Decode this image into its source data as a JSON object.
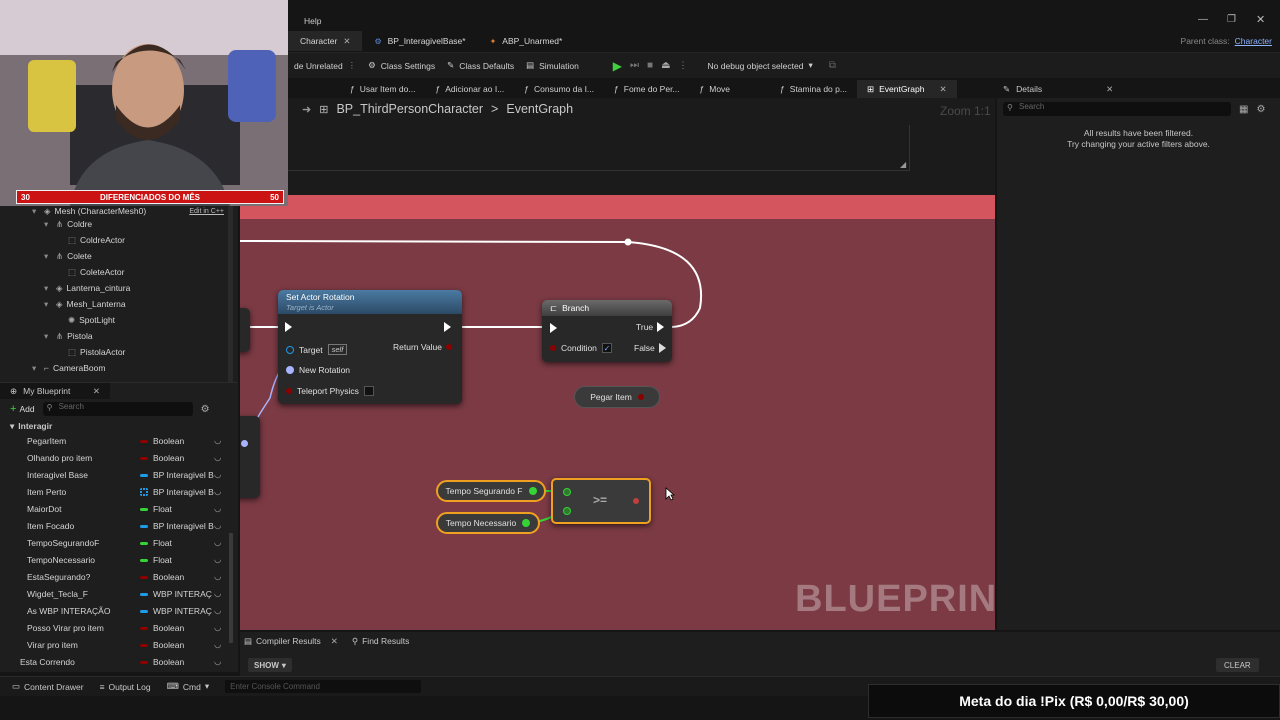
{
  "menubar": {
    "help_label": "Help",
    "parent_class_label": "Parent class:",
    "parent_class_value": "Character"
  },
  "tabs": [
    {
      "label": "Character",
      "closable": true
    },
    {
      "label": "BP_InteragivelBase*",
      "closable": false
    },
    {
      "label": "ABP_Unarmed*",
      "closable": false
    }
  ],
  "toolbar": {
    "hide_unrelated": "de Unrelated",
    "class_settings": "Class Settings",
    "class_defaults": "Class Defaults",
    "simulation": "Simulation",
    "debug_select": "No debug object selected"
  },
  "graph_tabs": [
    {
      "label": "Usar Item do..."
    },
    {
      "label": "Adicionar ao I..."
    },
    {
      "label": "Consumo da I..."
    },
    {
      "label": "Fome do Per..."
    },
    {
      "label": "Move"
    },
    {
      "label": "Stamina do p..."
    },
    {
      "label": "EventGraph",
      "active": true
    }
  ],
  "breadcrumb": {
    "root": "BP_ThirdPersonCharacter",
    "separator": ">",
    "current": "EventGraph",
    "zoom": "Zoom 1:1"
  },
  "webcam": {
    "banner_left": "30",
    "banner_text": "DIFERENCIADOS DO MÊS",
    "banner_right": "50"
  },
  "components_tree": [
    {
      "label": "Mesh (CharacterMesh0)",
      "indent": 1,
      "icon": "mesh",
      "extra": "Edit in C++"
    },
    {
      "label": "Coldre",
      "indent": 2,
      "icon": "scene"
    },
    {
      "label": "ColdreActor",
      "indent": 3,
      "icon": "actor"
    },
    {
      "label": "Colete",
      "indent": 2,
      "icon": "scene"
    },
    {
      "label": "ColeteActor",
      "indent": 3,
      "icon": "actor"
    },
    {
      "label": "Lanterna_cintura",
      "indent": 2,
      "icon": "mesh"
    },
    {
      "label": "Mesh_Lanterna",
      "indent": 2,
      "icon": "mesh"
    },
    {
      "label": "SpotLight",
      "indent": 3,
      "icon": "light"
    },
    {
      "label": "Pistola",
      "indent": 2,
      "icon": "scene"
    },
    {
      "label": "PistolaActor",
      "indent": 3,
      "icon": "actor"
    },
    {
      "label": "CameraBoom",
      "indent": 1,
      "icon": "camera"
    }
  ],
  "my_blueprint": {
    "title": "My Blueprint",
    "add_label": "Add",
    "search_placeholder": "Search",
    "category": "Interagir",
    "variables": [
      {
        "name": "PegarItem",
        "type": "Boolean",
        "color": "#8c0000"
      },
      {
        "name": "Olhando pro item",
        "type": "Boolean",
        "color": "#8c0000"
      },
      {
        "name": "Interagivel Base",
        "type": "BP Interagivel B",
        "color": "#1e9be8"
      },
      {
        "name": "Item Perto",
        "type": "BP Interagivel B",
        "color": "#1e9be8",
        "grid": true
      },
      {
        "name": "MaiorDot",
        "type": "Float",
        "color": "#35d335"
      },
      {
        "name": "Item Focado",
        "type": "BP Interagivel B",
        "color": "#1e9be8"
      },
      {
        "name": "TempoSegurandoF",
        "type": "Float",
        "color": "#35d335"
      },
      {
        "name": "TempoNecessario",
        "type": "Float",
        "color": "#35d335"
      },
      {
        "name": "EstaSegurando?",
        "type": "Boolean",
        "color": "#8c0000"
      },
      {
        "name": "Wigdet_Tecla_F",
        "type": "WBP INTERAÇ",
        "color": "#1e9be8"
      },
      {
        "name": "As WBP INTERAÇÃO",
        "type": "WBP INTERAÇ",
        "color": "#1e9be8"
      },
      {
        "name": "Posso Virar pro item",
        "type": "Boolean",
        "color": "#8c0000"
      },
      {
        "name": "Virar pro item",
        "type": "Boolean",
        "color": "#8c0000"
      },
      {
        "name": "Esta Correndo",
        "type": "Boolean",
        "color": "#8c0000"
      }
    ]
  },
  "nodes": {
    "set_actor_rotation": {
      "title": "Set Actor Rotation",
      "subtitle": "Target is Actor",
      "target": "Target",
      "self": "self",
      "new_rotation": "New Rotation",
      "teleport": "Teleport Physics",
      "return_value": "Return Value"
    },
    "branch": {
      "title": "Branch",
      "condition": "Condition",
      "true_label": "True",
      "false_label": "False"
    },
    "pegar_item": {
      "label": "Pegar Item"
    },
    "tempo_segurando": {
      "label": "Tempo Segurando F"
    },
    "tempo_necessario": {
      "label": "Tempo Necessario"
    },
    "compare": {
      "operator": ">="
    }
  },
  "watermark": "BLUEPRINT",
  "details": {
    "title": "Details",
    "search_placeholder": "Search",
    "empty_line1": "All results have been filtered.",
    "empty_line2": "Try changing your active filters above."
  },
  "bottom_panel": {
    "compiler_results": "Compiler Results",
    "find_results": "Find Results",
    "show": "SHOW",
    "clear": "CLEAR"
  },
  "statusbar": {
    "content_drawer": "Content Drawer",
    "output_log": "Output Log",
    "cmd": "Cmd",
    "console_placeholder": "Enter Console Command"
  },
  "overlay": {
    "meta": "Meta do dia !Pix (R$ 0,00/R$ 30,00)"
  },
  "colors": {
    "comment_bg": "#7b3a44",
    "comment_header": "#d4555e",
    "boolean": "#8c0000",
    "float": "#35d335",
    "object": "#1e9be8",
    "accent_orange": "#f0a020"
  }
}
